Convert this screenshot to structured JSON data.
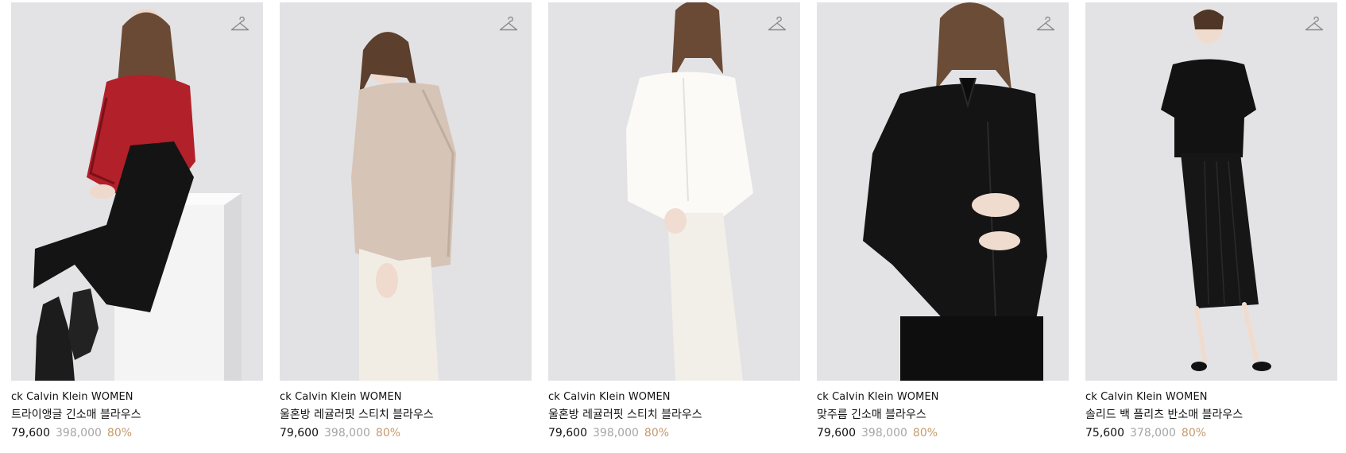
{
  "colors": {
    "background": "#ffffff",
    "photo_bg": "#e4e4e6",
    "text": "#111111",
    "original_price": "#a5a5a5",
    "discount": "#c49a6c"
  },
  "products": [
    {
      "brand": "ck Calvin Klein WOMEN",
      "name": "트라이앵글 긴소매 블라우스",
      "sale_price": "79,600",
      "original_price": "398,000",
      "discount": "80%",
      "wishlist_icon": "hanger-icon"
    },
    {
      "brand": "ck Calvin Klein WOMEN",
      "name": "울혼방 레귤러핏 스티치 블라우스",
      "sale_price": "79,600",
      "original_price": "398,000",
      "discount": "80%",
      "wishlist_icon": "hanger-icon"
    },
    {
      "brand": "ck Calvin Klein WOMEN",
      "name": "울혼방 레귤러핏 스티치 블라우스",
      "sale_price": "79,600",
      "original_price": "398,000",
      "discount": "80%",
      "wishlist_icon": "hanger-icon"
    },
    {
      "brand": "ck Calvin Klein WOMEN",
      "name": "맞주름 긴소매 블라우스",
      "sale_price": "79,600",
      "original_price": "398,000",
      "discount": "80%",
      "wishlist_icon": "hanger-icon"
    },
    {
      "brand": "ck Calvin Klein WOMEN",
      "name": "솔리드 백 플리츠 반소매 블라우스",
      "sale_price": "75,600",
      "original_price": "378,000",
      "discount": "80%",
      "wishlist_icon": "hanger-icon"
    }
  ]
}
